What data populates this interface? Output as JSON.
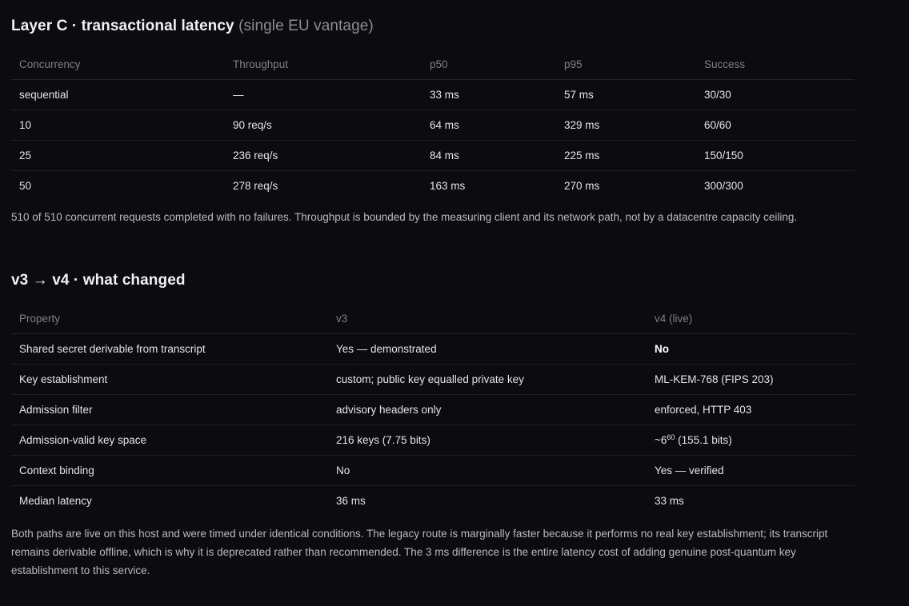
{
  "layer_c": {
    "title": "Layer C · transactional latency",
    "subtitle": "(single EU vantage)",
    "headers": [
      "Concurrency",
      "Throughput",
      "p50",
      "p95",
      "Success"
    ],
    "rows": [
      [
        "sequential",
        "—",
        "33 ms",
        "57 ms",
        "30/30"
      ],
      [
        "10",
        "90 req/s",
        "64 ms",
        "329 ms",
        "60/60"
      ],
      [
        "25",
        "236 req/s",
        "84 ms",
        "225 ms",
        "150/150"
      ],
      [
        "50",
        "278 req/s",
        "163 ms",
        "270 ms",
        "300/300"
      ]
    ],
    "note": "510 of 510 concurrent requests completed with no failures. Throughput is bounded by the measuring client and its network path, not by a datacentre capacity ceiling."
  },
  "changes": {
    "title": "v3 → v4 · what changed",
    "headers": [
      "Property",
      "v3",
      "v4 (live)"
    ],
    "rows": [
      [
        "Shared secret derivable from transcript",
        "Yes — demonstrated",
        "No"
      ],
      [
        "Key establishment",
        "custom; public key equalled private key",
        "ML-KEM-768 (FIPS 203)"
      ],
      [
        "Admission filter",
        "advisory headers only",
        "enforced, HTTP 403"
      ],
      [
        "Admission-valid key space",
        "216 keys (7.75 bits)",
        ""
      ],
      [
        "Context binding",
        "No",
        "Yes — verified"
      ],
      [
        "Median latency",
        "36 ms",
        "33 ms"
      ]
    ],
    "keyspace_v4": {
      "base": "~6",
      "exponent": "60",
      "rest": " (155.1 bits)"
    },
    "note": "Both paths are live on this host and were timed under identical conditions. The legacy route is marginally faster because it performs no real key establishment; its transcript remains derivable offline, which is why it is deprecated rather than recommended. The 3 ms difference is the entire latency cost of adding genuine post-quantum key establishment to this service."
  }
}
